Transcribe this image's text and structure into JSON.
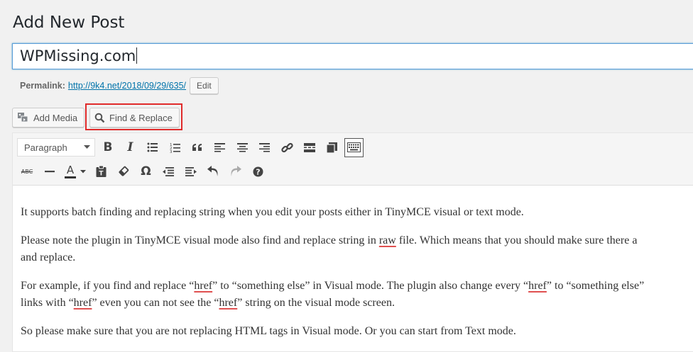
{
  "page_title": "Add New Post",
  "post_title_value": "WPMissing.com",
  "permalink": {
    "label": "Permalink:",
    "url": "http://9k4.net/2018/09/29/635/",
    "edit_label": "Edit"
  },
  "media_buttons": {
    "add_media": "Add Media",
    "find_replace": "Find & Replace"
  },
  "toolbar": {
    "format_select": "Paragraph",
    "row1_icons": [
      "bold-icon",
      "italic-icon",
      "bullet-list-icon",
      "numbered-list-icon",
      "blockquote-icon",
      "align-left-icon",
      "align-center-icon",
      "align-right-icon",
      "link-icon",
      "read-more-icon",
      "fullscreen-icon",
      "toolbar-toggle-icon"
    ],
    "row2_icons": [
      "strikethrough-icon",
      "horizontal-line-icon",
      "text-color-icon",
      "paste-text-icon",
      "clear-formatting-icon",
      "special-character-icon",
      "outdent-icon",
      "indent-icon",
      "undo-icon",
      "redo-icon",
      "help-icon"
    ],
    "bold_glyph": "B",
    "italic_glyph": "I",
    "omega_glyph": "Ω",
    "strike_glyph": "ABC",
    "color_glyph": "A",
    "help_glyph": "?"
  },
  "content": {
    "p1": "It supports batch finding and replacing string when you edit your posts either in TinyMCE visual or text mode.",
    "p2_a": "Please note the plugin in TinyMCE visual mode also find and replace string in ",
    "p2_raw": "raw",
    "p2_b": " file. Which means that you should make sure there a",
    "p2_line2": "and replace.",
    "p3_a": "For example, if you find and replace “",
    "p3_href1": "href",
    "p3_b": "” to “something else” in Visual mode. The plugin also change every “",
    "p3_href2": "href",
    "p3_c": "” to “something else”",
    "p3_d": "links with “",
    "p3_href3": "href",
    "p3_e": "” even you can not see the “",
    "p3_href4": "href",
    "p3_f": "” string on the visual mode screen.",
    "p4": "So please make sure that you are not replacing HTML tags in Visual mode. Or you can start from Text mode."
  },
  "colors": {
    "highlight_border": "#e02b2b",
    "link": "#0073aa",
    "focus_border": "#5b9dd9"
  }
}
